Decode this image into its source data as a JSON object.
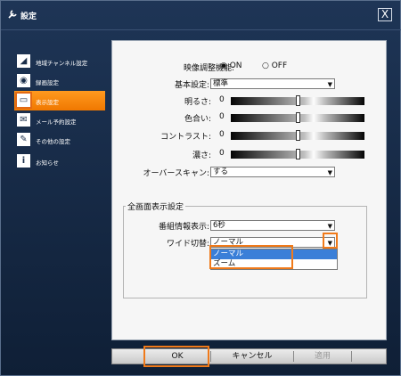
{
  "window": {
    "title": "設定",
    "close_label": "X"
  },
  "sidebar": {
    "items": [
      {
        "label": "地域チャンネル設定",
        "icon": "broadcast-icon",
        "active": false
      },
      {
        "label": "録画設定",
        "icon": "record-icon",
        "active": false
      },
      {
        "label": "表示設定",
        "icon": "display-icon",
        "active": true
      },
      {
        "label": "メール予約設定",
        "icon": "mail-icon",
        "active": false
      },
      {
        "label": "その他の設定",
        "icon": "wrench-icon",
        "active": false
      },
      {
        "label": "お知らせ",
        "icon": "info-icon",
        "active": false
      }
    ]
  },
  "settings": {
    "video_adjust": {
      "label": "映像調整機能:",
      "options": [
        "ON",
        "OFF"
      ],
      "selected": "ON"
    },
    "basic": {
      "label": "基本設定:",
      "value": "標準"
    },
    "brightness": {
      "label": "明るさ:",
      "value": "0",
      "level": 0.5
    },
    "color": {
      "label": "色合い:",
      "value": "0",
      "level": 0.5
    },
    "contrast": {
      "label": "コントラスト:",
      "value": "0",
      "level": 0.5
    },
    "density": {
      "label": "濃さ:",
      "value": "0",
      "level": 0.5
    },
    "overscan": {
      "label": "オーバースキャン:",
      "value": "する"
    }
  },
  "fullscreen": {
    "group_title": "全画面表示設定",
    "program_info": {
      "label": "番組情報表示:",
      "value": "6秒"
    },
    "wide_switch": {
      "label": "ワイド切替:",
      "value": "ノーマル",
      "options": [
        "ノーマル",
        "ズーム"
      ]
    }
  },
  "footer": {
    "ok_label": "OK",
    "cancel_label": "キャンセル",
    "apply_label": "適用"
  },
  "colors": {
    "accent": "#f07a1a",
    "background": "#1a2e4a",
    "selection": "#3a7fd8"
  }
}
